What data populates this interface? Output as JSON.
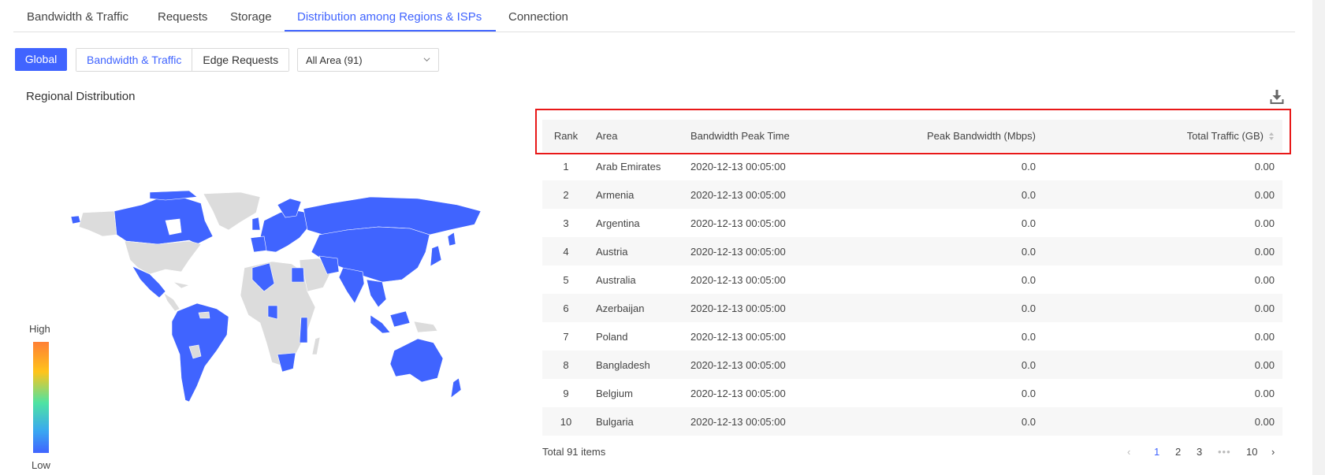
{
  "tabs": [
    {
      "label": "Bandwidth & Traffic",
      "active": false
    },
    {
      "label": "Requests",
      "active": false
    },
    {
      "label": "Storage",
      "active": false
    },
    {
      "label": "Distribution among Regions & ISPs",
      "active": true
    },
    {
      "label": "Connection",
      "active": false
    }
  ],
  "filters": {
    "global_label": "Global",
    "segments": [
      {
        "label": "Bandwidth & Traffic",
        "active": true
      },
      {
        "label": "Edge Requests",
        "active": false
      }
    ],
    "area_select": {
      "value": "All Area (91)"
    }
  },
  "section": {
    "title": "Regional Distribution",
    "download_icon": "download-icon"
  },
  "map": {
    "legend_high": "High",
    "legend_low": "Low",
    "legend_colors": [
      "#ff7f35",
      "#ffc41a",
      "#4ee3a3",
      "#3aa8f0",
      "#4064ff"
    ],
    "highlight_color": "#4064ff",
    "inactive_color": "#dcdcdc"
  },
  "table": {
    "columns": [
      "Rank",
      "Area",
      "Bandwidth Peak Time",
      "Peak Bandwidth (Mbps)",
      "Total Traffic (GB)"
    ],
    "rows": [
      {
        "rank": "1",
        "area": "Arab Emirates",
        "time": "2020-12-13 00:05:00",
        "peak": "0.0",
        "total": "0.00"
      },
      {
        "rank": "2",
        "area": "Armenia",
        "time": "2020-12-13 00:05:00",
        "peak": "0.0",
        "total": "0.00"
      },
      {
        "rank": "3",
        "area": "Argentina",
        "time": "2020-12-13 00:05:00",
        "peak": "0.0",
        "total": "0.00"
      },
      {
        "rank": "4",
        "area": "Austria",
        "time": "2020-12-13 00:05:00",
        "peak": "0.0",
        "total": "0.00"
      },
      {
        "rank": "5",
        "area": "Australia",
        "time": "2020-12-13 00:05:00",
        "peak": "0.0",
        "total": "0.00"
      },
      {
        "rank": "6",
        "area": "Azerbaijan",
        "time": "2020-12-13 00:05:00",
        "peak": "0.0",
        "total": "0.00"
      },
      {
        "rank": "7",
        "area": "Poland",
        "time": "2020-12-13 00:05:00",
        "peak": "0.0",
        "total": "0.00"
      },
      {
        "rank": "8",
        "area": "Bangladesh",
        "time": "2020-12-13 00:05:00",
        "peak": "0.0",
        "total": "0.00"
      },
      {
        "rank": "9",
        "area": "Belgium",
        "time": "2020-12-13 00:05:00",
        "peak": "0.0",
        "total": "0.00"
      },
      {
        "rank": "10",
        "area": "Bulgaria",
        "time": "2020-12-13 00:05:00",
        "peak": "0.0",
        "total": "0.00"
      }
    ],
    "total_text": "Total 91 items"
  },
  "pagination": {
    "prev": "‹",
    "pages": [
      "1",
      "2",
      "3"
    ],
    "ellipsis": "•••",
    "last": "10",
    "next": "›",
    "current": "1"
  }
}
